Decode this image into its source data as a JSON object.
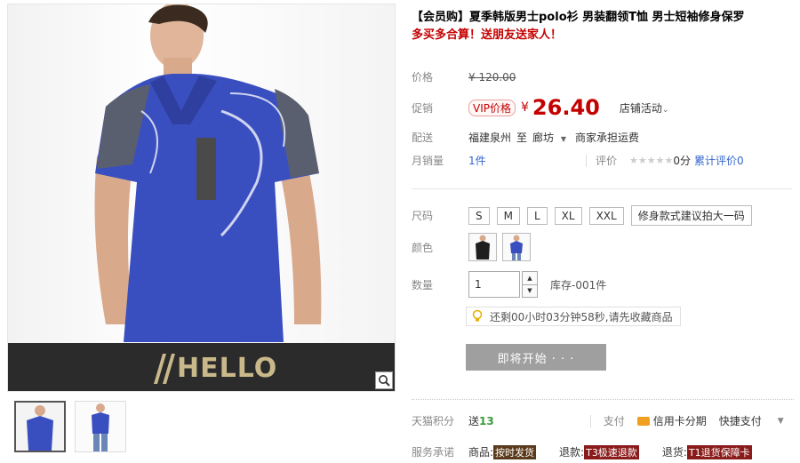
{
  "product": {
    "title": "【会员购】夏季韩版男士polo衫 男装翻领T恤 男士短袖修身保罗",
    "subtitle": "多买多合算！送朋友送家人！"
  },
  "brand": {
    "logo_text": "HELLO"
  },
  "price": {
    "label": "价格",
    "original": "¥ 120.00",
    "promo_label": "促销",
    "vip_tag": "VIP价格",
    "currency": "¥",
    "vip_price": "26.40",
    "shop_activity": "店铺活动"
  },
  "delivery": {
    "label": "配送",
    "from": "福建泉州",
    "to_word": "至",
    "to": "廊坊",
    "fee": "商家承担运费"
  },
  "sales": {
    "label": "月销量",
    "count": "1件",
    "rating_label": "评价",
    "score": "0分",
    "total_label": "累计评价0"
  },
  "size": {
    "label": "尺码",
    "options": [
      "S",
      "M",
      "L",
      "XL",
      "XXL"
    ],
    "tip": "修身款式建议拍大一码"
  },
  "color": {
    "label": "颜色"
  },
  "quantity": {
    "label": "数量",
    "value": "1",
    "up": "▲",
    "down": "▼",
    "stock": "库存-001件"
  },
  "notice": {
    "text": "还剩00小时03分钟58秒,请先收藏商品"
  },
  "start_button": {
    "label": "即将开始 · · ·"
  },
  "points": {
    "label": "天猫积分",
    "send": "送",
    "value": "13",
    "pay_label": "支付",
    "credit": "信用卡分期",
    "quick": "快捷支付"
  },
  "service": {
    "label": "服务承诺",
    "items": [
      {
        "prefix": "商品:",
        "tag": "按时发货"
      },
      {
        "prefix": "退款:",
        "tag": "T3极速退款"
      },
      {
        "prefix": "退货:",
        "tag": "T1退货保障卡"
      }
    ]
  },
  "colors": {
    "price_red": "#c40000",
    "shirt_blue": "#3a4fbf",
    "brand_gold": "#c9b88a",
    "button_gray": "#9f9f9f"
  }
}
